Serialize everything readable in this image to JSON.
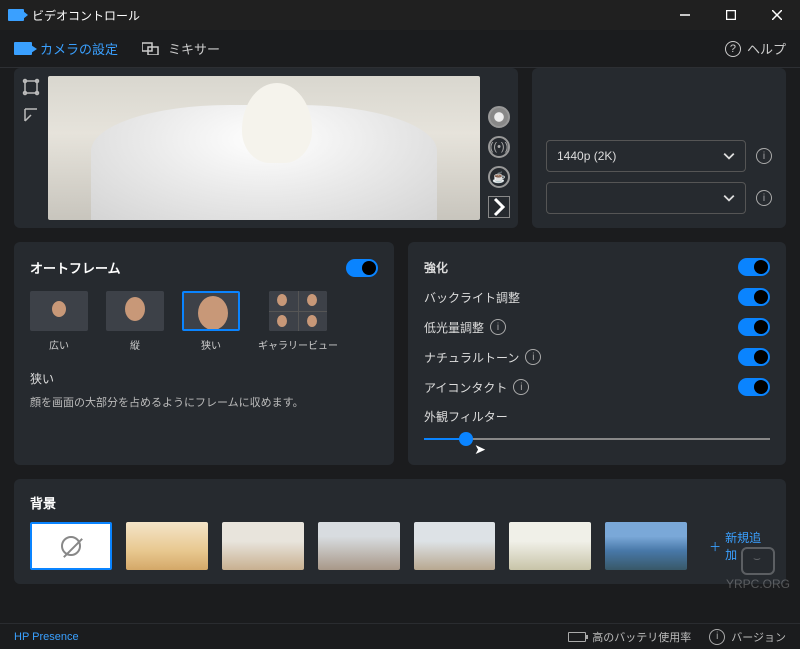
{
  "window": {
    "title": "ビデオコントロール"
  },
  "tabs": {
    "camera": "カメラの設定",
    "mixer": "ミキサー"
  },
  "help": "ヘルプ",
  "resolution": {
    "selected": "1440p (2K)"
  },
  "autoframe": {
    "title": "オートフレーム",
    "options": {
      "wide": "広い",
      "vertical": "縦",
      "narrow": "狭い",
      "gallery": "ギャラリービュー"
    },
    "selected_label": "狭い",
    "description": "顔を画面の大部分を占めるようにフレームに収めます。"
  },
  "enhance": {
    "title": "強化",
    "backlight": "バックライト調整",
    "lowlight": "低光量調整",
    "natural": "ナチュラルトーン",
    "eyecontact": "アイコンタクト",
    "appearance": "外観フィルター"
  },
  "background": {
    "title": "背景",
    "add_new": "新規追加"
  },
  "status": {
    "brand": "HP Presence",
    "battery": "高のバッテリ使用率",
    "version_prefix": "バージョン"
  },
  "watermark": "YRPC.ORG"
}
